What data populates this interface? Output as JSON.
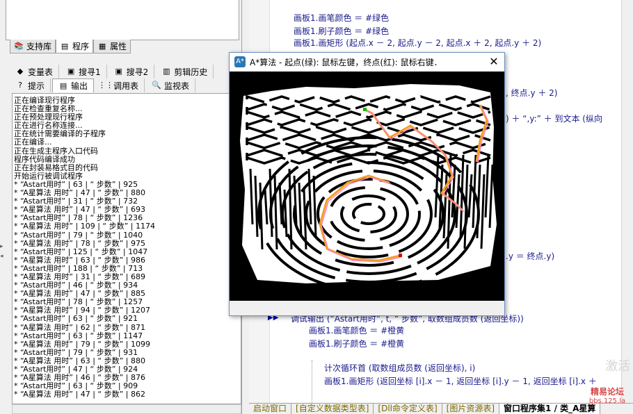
{
  "left_panel": {
    "tabs_top": [
      {
        "label": "支持库",
        "icon": "library-icon"
      },
      {
        "label": "程序",
        "icon": "program-icon"
      },
      {
        "label": "属性",
        "icon": "properties-icon"
      }
    ],
    "tabs_row2": [
      {
        "label": "变量表",
        "icon": "variables-icon"
      },
      {
        "label": "搜寻1",
        "icon": "search1-icon"
      },
      {
        "label": "搜寻2",
        "icon": "search2-icon"
      },
      {
        "label": "剪辑历史",
        "icon": "clip-history-icon"
      }
    ],
    "tabs_row3": [
      {
        "label": "提示",
        "icon": "hint-icon"
      },
      {
        "label": "输出",
        "icon": "output-icon"
      },
      {
        "label": "调用表",
        "icon": "call-table-icon"
      },
      {
        "label": "监视表",
        "icon": "watch-icon"
      }
    ],
    "output_lines": [
      "正在编译现行程序",
      "正在检查重复名称...",
      "正在预处理现行程序",
      "正在进行名称连接...",
      "正在统计需要编译的子程序",
      "正在编译...",
      "正在生成主程序入口代码",
      "程序代码编译成功",
      "正在封装易格式目的代码",
      "开始运行被调试程序",
      "* “Astart用时” | 63 | “ 步数” | 925",
      "* “A星算法 用时” | 47 | “ 步数” | 880",
      "* “Astart用时” | 31 | “ 步数” | 732",
      "* “A星算法 用时” | 47 | “ 步数” | 693",
      "* “Astart用时” | 78 | “ 步数” | 1236",
      "* “A星算法 用时” | 109 | “ 步数” | 1174",
      "* “Astart用时” | 79 | “ 步数” | 1040",
      "* “A星算法 用时” | 78 | “ 步数” | 975",
      "* “Astart用时” | 125 | “ 步数” | 1047",
      "* “A星算法 用时” | 63 | “ 步数” | 986",
      "* “Astart用时” | 188 | “ 步数” | 713",
      "* “A星算法 用时” | 31 | “ 步数” | 689",
      "* “Astart用时” | 46 | “ 步数” | 934",
      "* “A星算法 用时” | 47 | “ 步数” | 885",
      "* “Astart用时” | 78 | “ 步数” | 1257",
      "* “A星算法 用时” | 94 | “ 步数” | 1207",
      "* “Astart用时” | 63 | “ 步数” | 921",
      "* “A星算法 用时” | 62 | “ 步数” | 871",
      "* “Astart用时” | 63 | “ 步数” | 1147",
      "* “A星算法 用时” | 79 | “ 步数” | 1099",
      "* “Astart用时” | 79 | “ 步数” | 931",
      "* “A星算法 用时” | 63 | “ 步数” | 880",
      "* “Astart用时” | 47 | “ 步数” | 924",
      "* “A星算法 用时” | 46 | “ 步数” | 876",
      "* “Astart用时” | 63 | “ 步数” | 909",
      "* “A星算法 用时” | 47 | “ 步数” | 862"
    ]
  },
  "editor": {
    "top_lines": [
      "画板1.画笔颜色 ＝ #绿色",
      "画板1.刷子颜色 ＝ #绿色",
      "画板1.画矩形 (起点.x － 2, 起点.y － 2, 起点.x ＋ 2, 起点.y ＋ 2)"
    ],
    "fragment_1": ", 终点.y ＋ 2)",
    "fragment_2": ") ＋ “,y:” ＋ 到文本 (纵向",
    "fragment_3": ".y ＝ 终点.y)",
    "debug_line": "调试输出 (“Astart用时”, t, “ 步数”, 取数组成员数 (返回坐标))",
    "lines_after": [
      "画板1.画笔颜色 ＝ #橙黄",
      "画板1.刷子颜色 ＝ #橙黄"
    ],
    "loop_line": "计次循环首 (取数组成员数 (返回坐标), i)",
    "rect_line": "画板1.画矩形 (返回坐标 [i].x － 1, 返回坐标 [i].y － 1, 返回坐标 [i].x ＋",
    "watermark": "激活",
    "forum_name": "精易论坛",
    "forum_url": "bbs.125.la"
  },
  "bottom_tabs": [
    "启动窗口",
    "[自定义数据类型表]",
    "[Dll命令定义表]",
    "[图片资源表]",
    "窗口程序集1 / 类_A星算"
  ],
  "astar_window": {
    "title": "A*算法 - 起点(绿): 鼠标左键，终点(红): 鼠标右键．",
    "icon_text": "A*",
    "close_glyph": "✕"
  },
  "colors": {
    "green": "#00c000",
    "orange": "#f0a020",
    "pink": "#ff80c0",
    "red": "#e00000"
  }
}
